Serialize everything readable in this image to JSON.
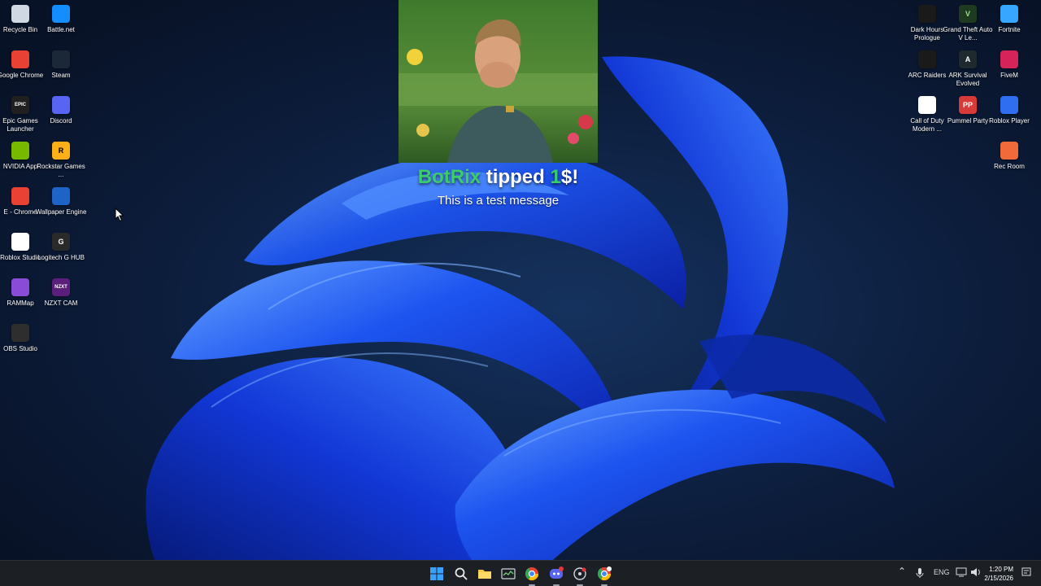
{
  "desktop": {
    "left_icons": [
      {
        "label": "Recycle Bin",
        "icon": "recycle-bin-icon",
        "color": "#cfd8e3",
        "short": "",
        "text_color": "#000"
      },
      {
        "label": "Battle.net",
        "icon": "battlenet-icon",
        "color": "#148eff",
        "short": "",
        "text_color": "#fff"
      },
      {
        "label": "Google Chrome",
        "icon": "chrome-icon",
        "color": "#e94235",
        "short": "",
        "text_color": "#fff"
      },
      {
        "label": "Steam",
        "icon": "steam-icon",
        "color": "#1b2838",
        "short": "",
        "text_color": "#fff"
      },
      {
        "label": "Epic Games Launcher",
        "icon": "epic-games-icon",
        "color": "#202020",
        "short": "EPIC",
        "text_color": "#fff"
      },
      {
        "label": "Discord",
        "icon": "discord-icon",
        "color": "#5865f2",
        "short": "",
        "text_color": "#fff"
      },
      {
        "label": "NVIDIA App",
        "icon": "nvidia-icon",
        "color": "#76b900",
        "short": "",
        "text_color": "#fff"
      },
      {
        "label": "Rockstar Games ...",
        "icon": "rockstar-icon",
        "color": "#fcaf17",
        "short": "R",
        "text_color": "#000"
      },
      {
        "label": "E - Chrome",
        "icon": "chrome-icon",
        "color": "#e94235",
        "short": "",
        "text_color": "#fff"
      },
      {
        "label": "Wallpaper Engine",
        "icon": "wallpaper-engine-icon",
        "color": "#1e63c6",
        "short": "",
        "text_color": "#fff"
      },
      {
        "label": "Roblox Studio",
        "icon": "roblox-studio-icon",
        "color": "#ffffff",
        "short": "",
        "text_color": "#000"
      },
      {
        "label": "Logitech G HUB",
        "icon": "logitech-icon",
        "color": "#2a2a2a",
        "short": "G",
        "text_color": "#fff"
      },
      {
        "label": "RAMMap",
        "icon": "rammap-icon",
        "color": "#8a4bd6",
        "short": "",
        "text_color": "#fff"
      },
      {
        "label": "NZXT CAM",
        "icon": "nzxt-icon",
        "color": "#5a1f7a",
        "short": "NZXT",
        "text_color": "#fff"
      },
      {
        "label": "OBS Studio",
        "icon": "obs-icon",
        "color": "#2e2e2e",
        "short": "",
        "text_color": "#fff"
      }
    ],
    "right_icons": [
      {
        "label": "Dark Hours Prologue",
        "icon": "dark-hours-icon",
        "color": "#1a1a1a",
        "short": "",
        "text_color": "#fff"
      },
      {
        "label": "Grand Theft Auto V Le...",
        "icon": "gta-icon",
        "color": "#1e3a20",
        "short": "V",
        "text_color": "#9be28c"
      },
      {
        "label": "Fortnite",
        "icon": "fortnite-icon",
        "color": "#37a6ff",
        "short": "",
        "text_color": "#fff"
      },
      {
        "label": "ARC Raiders",
        "icon": "arc-raiders-icon",
        "color": "#1a1a1a",
        "short": "",
        "text_color": "#fff"
      },
      {
        "label": "ARK Survival Evolved",
        "icon": "ark-icon",
        "color": "#1e2a2e",
        "short": "A",
        "text_color": "#fff"
      },
      {
        "label": "FiveM",
        "icon": "fivem-icon",
        "color": "#d6245a",
        "short": "",
        "text_color": "#fff"
      },
      {
        "label": "Call of Duty Modern ...",
        "icon": "call-of-duty-icon",
        "color": "#ffffff",
        "short": "",
        "text_color": "#000"
      },
      {
        "label": "Pummel Party",
        "icon": "pummel-party-icon",
        "color": "#d83a3a",
        "short": "PP",
        "text_color": "#fff"
      },
      {
        "label": "Roblox Player",
        "icon": "roblox-player-icon",
        "color": "#2f6ef0",
        "short": "",
        "text_color": "#fff"
      },
      {
        "label": "Rec Room",
        "icon": "rec-room-icon",
        "color": "#f06a3a",
        "short": "",
        "text_color": "#fff"
      }
    ]
  },
  "alert": {
    "name": "BotRix",
    "action": "tipped",
    "amount": "1",
    "currency": "$!",
    "message": "This is a test message"
  },
  "taskbar": {
    "buttons": [
      {
        "name": "start-icon",
        "active": false
      },
      {
        "name": "search-icon",
        "active": false
      },
      {
        "name": "file-explorer-icon",
        "active": false
      },
      {
        "name": "task-manager-icon",
        "active": false
      },
      {
        "name": "chrome-icon",
        "active": true
      },
      {
        "name": "discord-icon",
        "active": true
      },
      {
        "name": "davinci-icon",
        "active": true
      },
      {
        "name": "chrome-profile-icon",
        "active": true
      }
    ],
    "tray": {
      "language": "ENG",
      "time": "1:20 PM",
      "date": "2/15/2026"
    }
  }
}
